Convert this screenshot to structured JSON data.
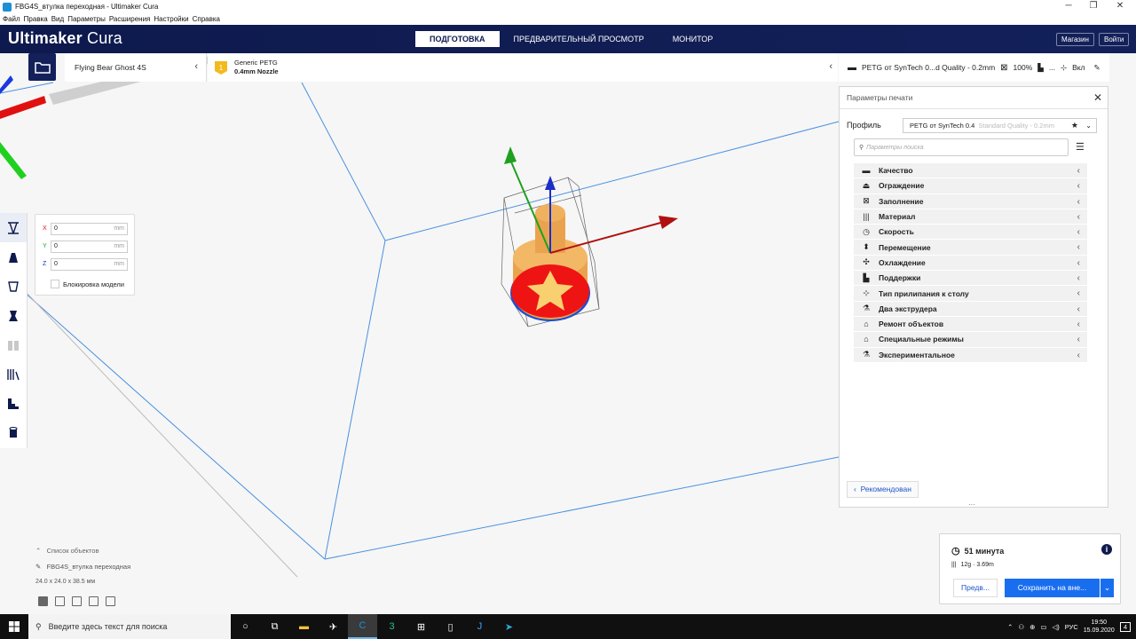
{
  "window": {
    "title": "FBG4S_втулка переходная - Ultimaker Cura"
  },
  "menu": [
    "Файл",
    "Правка",
    "Вид",
    "Параметры",
    "Расширения",
    "Настройки",
    "Справка"
  ],
  "header": {
    "logo_bold": "Ultimaker",
    "logo_light": " Cura",
    "tabs": [
      {
        "label": "ПОДГОТОВКА",
        "active": true
      },
      {
        "label": "ПРЕДВАРИТЕЛЬНЫЙ ПРОСМОТР",
        "active": false
      },
      {
        "label": "МОНИТОР",
        "active": false
      }
    ],
    "marketplace": "Магазин",
    "signin": "Войти"
  },
  "machine": {
    "name": "Flying Bear Ghost 4S"
  },
  "material": {
    "name": "Generic PETG",
    "nozzle": "0.4mm Nozzle",
    "badge": "1",
    "accent": "#f3ba1c"
  },
  "settings_summary": {
    "profile": "PETG от SynTech 0...d Quality - 0.2mm",
    "infill": "100%",
    "support": "...",
    "adhesion": "Вкл"
  },
  "move_tool": {
    "x": {
      "label": "X",
      "value": "0",
      "unit": "mm"
    },
    "y": {
      "label": "Y",
      "value": "0",
      "unit": "mm"
    },
    "z": {
      "label": "Z",
      "value": "0",
      "unit": "mm"
    },
    "lock_label": "Блокировка модели"
  },
  "print_settings": {
    "title": "Параметры печати",
    "profile_label": "Профиль",
    "profile_value": "PETG от SynTech 0.4",
    "profile_quality": "Standard Quality - 0.2mm",
    "search_placeholder": "Параметры поиска",
    "categories": [
      {
        "label": "Качество",
        "icon": "quality-icon",
        "glyph": "▬"
      },
      {
        "label": "Ограждение",
        "icon": "shell-icon",
        "glyph": "⏏"
      },
      {
        "label": "Заполнение",
        "icon": "infill-icon",
        "glyph": "⊠"
      },
      {
        "label": "Материал",
        "icon": "material-icon",
        "glyph": "|||"
      },
      {
        "label": "Скорость",
        "icon": "speed-icon",
        "glyph": "◷"
      },
      {
        "label": "Перемещение",
        "icon": "travel-icon",
        "glyph": "⬍"
      },
      {
        "label": "Охлаждение",
        "icon": "cooling-icon",
        "glyph": "✣"
      },
      {
        "label": "Поддержки",
        "icon": "support-icon",
        "glyph": "▙"
      },
      {
        "label": "Тип прилипания к столу",
        "icon": "adhesion-icon",
        "glyph": "⊹"
      },
      {
        "label": "Два экструдера",
        "icon": "dual-extruder-icon",
        "glyph": "⚗"
      },
      {
        "label": "Ремонт объектов",
        "icon": "mesh-fix-icon",
        "glyph": "⌂"
      },
      {
        "label": "Специальные режимы",
        "icon": "special-modes-icon",
        "glyph": "⌂"
      },
      {
        "label": "Экспериментальное",
        "icon": "experimental-icon",
        "glyph": "⚗"
      }
    ],
    "recommended": "Рекомендован"
  },
  "object_list": {
    "header": "Список объектов",
    "object": "FBG4S_втулка переходная",
    "dims": "24.0 x 24.0 x 38.5 мм"
  },
  "action": {
    "time": "51 минута",
    "material": "12g · 3.69m",
    "preview": "Предв...",
    "save": "Сохранить на вне..."
  },
  "taskbar": {
    "search": "Введите здесь текст для поиска",
    "lang": "РУС",
    "time": "19:50",
    "date": "15.09.2020",
    "notif": "4"
  }
}
